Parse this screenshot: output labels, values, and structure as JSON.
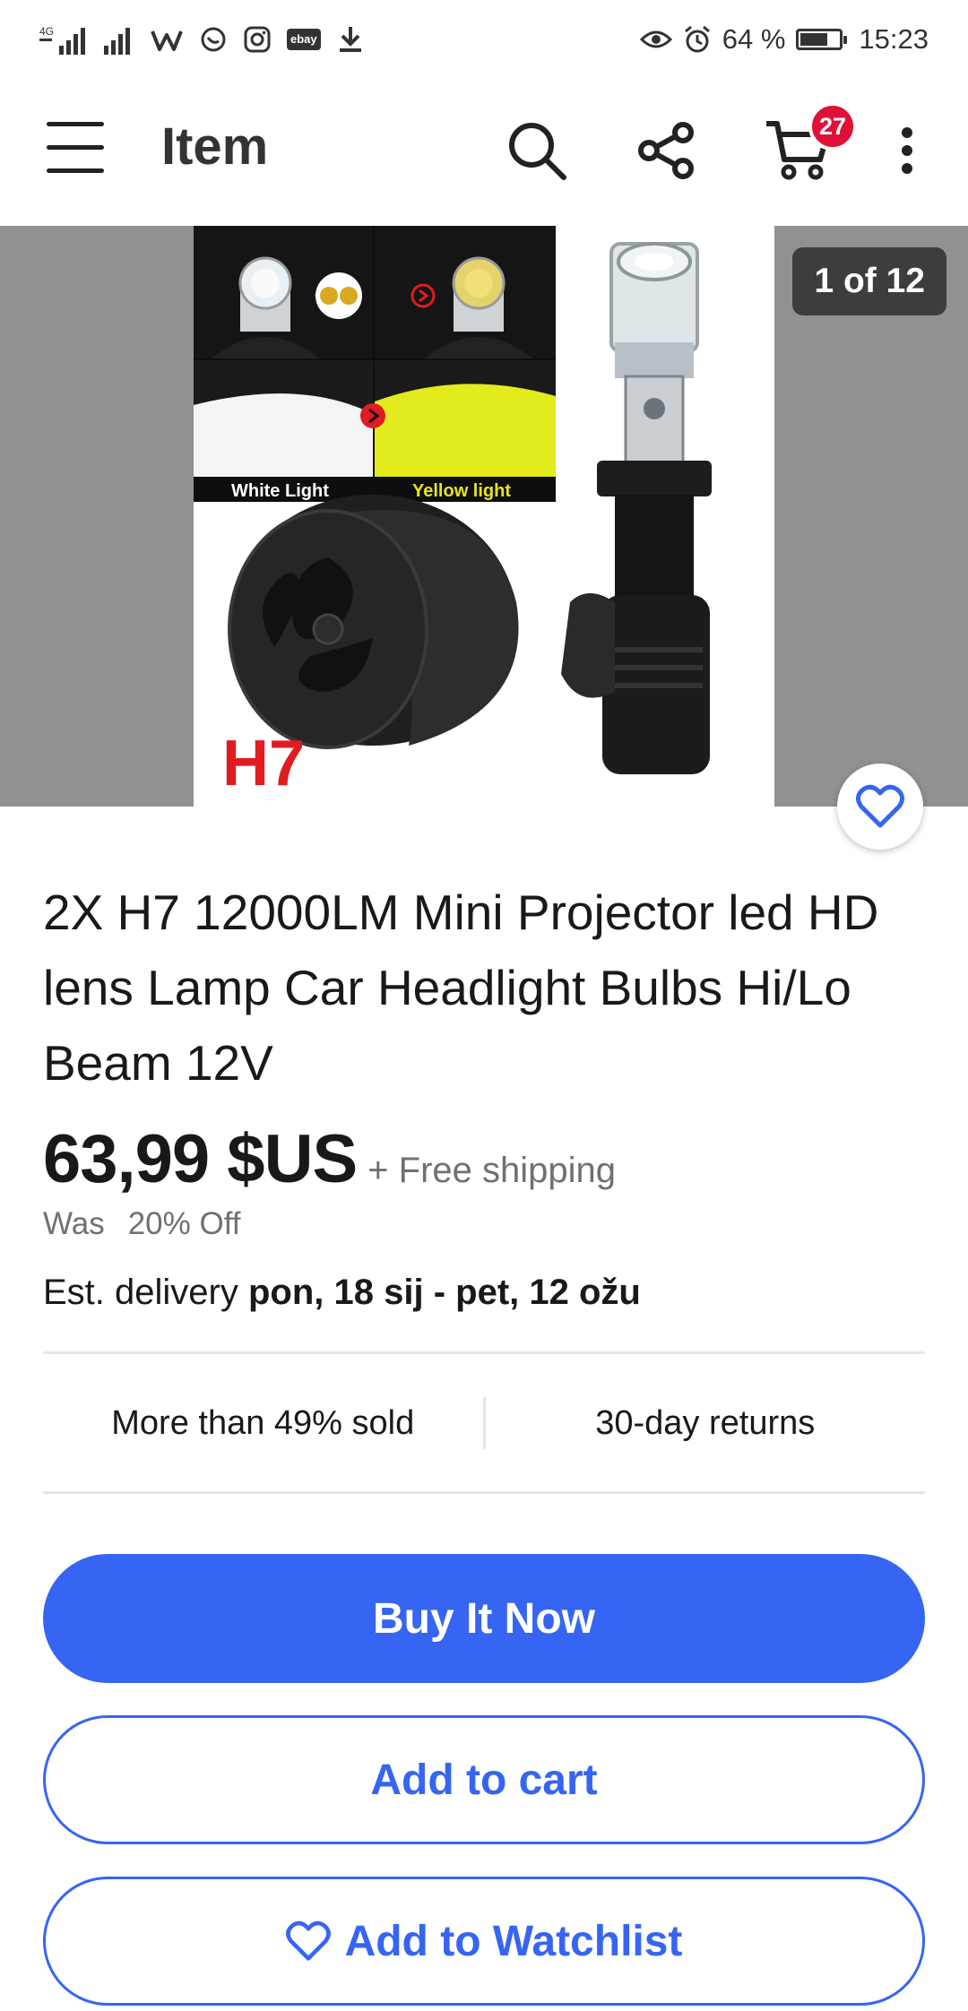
{
  "status_bar": {
    "network_left": "4G",
    "ebay_badge": "ebay",
    "battery_percent": "64 %",
    "battery_level": 0.64,
    "time": "15:23"
  },
  "header": {
    "title": "Item",
    "cart_count": "27",
    "icons": [
      "menu-icon",
      "search-icon",
      "share-icon",
      "cart-icon",
      "more-vert-icon"
    ]
  },
  "gallery": {
    "counter": "1 of 12",
    "image_labels": {
      "white_light": "White Light",
      "yellow_light": "Yellow light",
      "model": "H7"
    }
  },
  "listing": {
    "title": "2X H7 12000LM Mini Projector led HD lens Lamp Car Headlight Bulbs Hi/Lo Beam 12V",
    "price": "63,99 $US",
    "shipping": "+ Free shipping",
    "was_label": "Was",
    "discount": "20% Off",
    "delivery_label": "Est. delivery",
    "delivery_dates": "pon, 18 sij - pet, 12 ožu",
    "sold_text": "More than 49% sold",
    "returns_text": "30-day returns"
  },
  "actions": {
    "buy_now": "Buy It Now",
    "add_to_cart": "Add to cart",
    "add_to_watchlist": "Add to Watchlist"
  },
  "colors": {
    "accent": "#3665f3",
    "badge": "#e0103a",
    "gallery_bg": "#919191"
  }
}
